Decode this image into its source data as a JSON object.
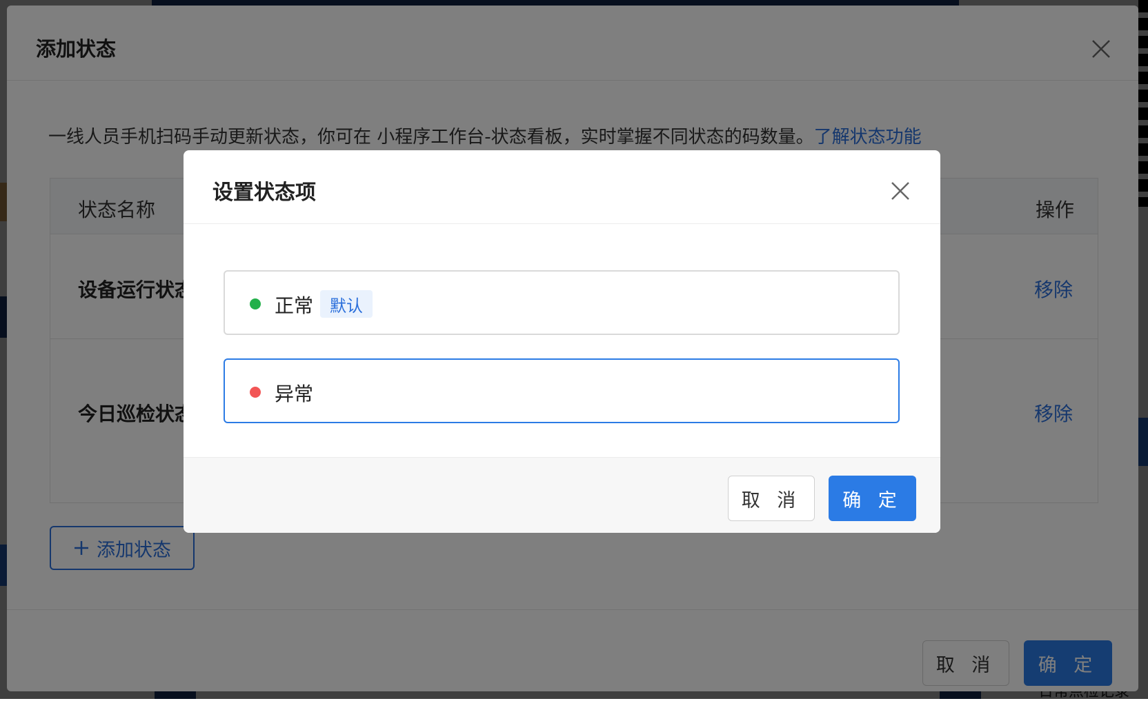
{
  "background": {
    "text_fragments": [
      "一线人员手机扫码手动更新状态，你可在 小程序工作台-状态看板，实时掌握不同状态的码数量。",
      "操作",
      "日常点检记录"
    ]
  },
  "outer_dialog": {
    "title": "添加状态",
    "description": "一线人员手机扫码手动更新状态，你可在 小程序工作台-状态看板，实时掌握不同状态的码数量。",
    "description_link": "了解状态功能",
    "table": {
      "col_name": "状态名称",
      "col_action": "操作",
      "rows": [
        {
          "name": "设备运行状态",
          "action": "移除"
        },
        {
          "name": "今日巡检状态",
          "action": "移除"
        }
      ]
    },
    "add_button": "添加状态",
    "cancel_button": "取 消",
    "ok_button": "确 定"
  },
  "inner_dialog": {
    "title": "设置状态项",
    "items": [
      {
        "label": "正常",
        "tag": "默认",
        "dot_color": "#23b04a"
      },
      {
        "label": "异常",
        "dot_color": "#f25555"
      }
    ],
    "cancel_button": "取 消",
    "ok_button": "确 定"
  },
  "colors": {
    "primary": "#2b7be5",
    "link": "#2b6fdb"
  }
}
